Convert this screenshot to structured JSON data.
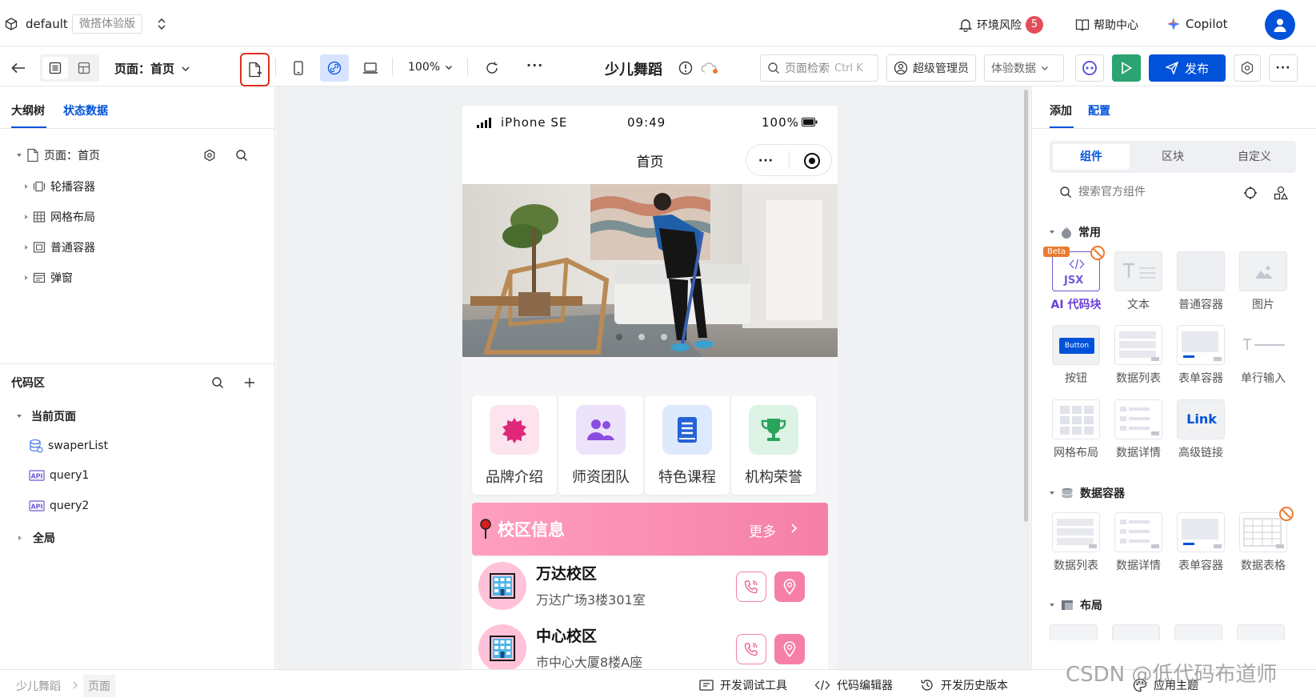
{
  "app": {
    "workspace": "default",
    "edition": "微搭体验版",
    "env_risk_label": "环境风险",
    "env_risk_count": "5",
    "help_label": "帮助中心",
    "copilot_label": "Copilot"
  },
  "toolbar": {
    "page_label": "页面：首页",
    "zoom": "100%",
    "app_title": "少儿舞蹈",
    "search_label": "页面检索",
    "search_shortcut": "Ctrl K",
    "admin_label": "超级管理员",
    "data_mode": "体验数据",
    "publish_label": "发布",
    "more": "···"
  },
  "left": {
    "tabs": [
      "大纲树",
      "状态数据"
    ],
    "tree_root": "页面：首页",
    "tree_items": [
      "轮播容器",
      "网格布局",
      "普通容器",
      "弹窗"
    ],
    "code_title": "代码区",
    "current_page": "当前页面",
    "code_items": [
      "swaperList",
      "query1",
      "query2"
    ],
    "global": "全局"
  },
  "phone": {
    "device": "iPhone SE",
    "time": "09:49",
    "battery": "100%",
    "nav_title": "首页",
    "quick": [
      "品牌介绍",
      "师资团队",
      "特色课程",
      "机构荣誉"
    ],
    "campus_header": "校区信息",
    "campus_more": "更多",
    "campuses": [
      {
        "name": "万达校区",
        "addr": "万达广场3楼301室"
      },
      {
        "name": "中心校区",
        "addr": "市中心大厦8楼A座"
      }
    ]
  },
  "right": {
    "tabs": [
      "添加",
      "配置"
    ],
    "seg": [
      "组件",
      "区块",
      "自定义"
    ],
    "search_placeholder": "搜索官方组件",
    "section_common": "常用",
    "common": [
      "AI 代码块",
      "文本",
      "普通容器",
      "图片",
      "按钮",
      "数据列表",
      "表单容器",
      "单行输入",
      "网格布局",
      "数据详情",
      "高级链接"
    ],
    "beta": "Beta",
    "jsx": "JSX",
    "button_sample": "Button",
    "link_sample": "Link",
    "section_data": "数据容器",
    "data": [
      "数据列表",
      "数据详情",
      "表单容器",
      "数据表格"
    ],
    "section_layout": "布局"
  },
  "bottom": {
    "breadcrumb": [
      "少儿舞蹈",
      "页面"
    ],
    "tools": [
      "开发调试工具",
      "代码编辑器",
      "开发历史版本",
      "应用主题"
    ],
    "watermark": "CSDN @低代码布道师"
  },
  "colors": {
    "brand": "#0052d9",
    "green": "#2ba471",
    "pink": "#f57fa8",
    "badge": "#e34d59"
  }
}
